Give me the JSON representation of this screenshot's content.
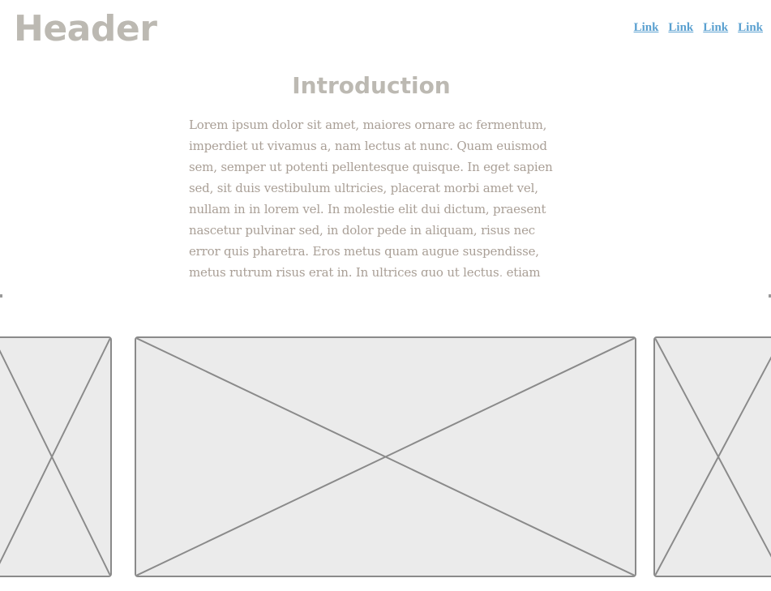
{
  "header": {
    "title": "Header",
    "nav_links": [
      "Link",
      "Link",
      "Link",
      "Link"
    ]
  },
  "main": {
    "intro_title": "Introduction",
    "intro_text": "Lorem ipsum dolor sit amet, maiores ornare ac fermentum, imperdiet ut vivamus a, nam lectus at nunc. Quam euismod sem, semper ut potenti pellentesque quisque. In eget sapien sed, sit duis vestibulum ultricies, placerat morbi amet vel, nullam in in lorem vel. In molestie elit dui dictum, praesent nascetur pulvinar sed, in dolor pede in aliquam, risus nec error quis pharetra. Eros metus quam augue suspendisse, metus rutrum risus erat in. In ultrices quo ut lectus, etiam"
  },
  "carousel": {
    "items": [
      "image-placeholder-left",
      "image-placeholder-center",
      "image-placeholder-right"
    ]
  },
  "colors": {
    "heading": "#bcb9b2",
    "body_text": "#a99f96",
    "link": "#5aa0d0",
    "placeholder_fill": "#ebebeb",
    "placeholder_stroke": "#8a8a8a"
  }
}
